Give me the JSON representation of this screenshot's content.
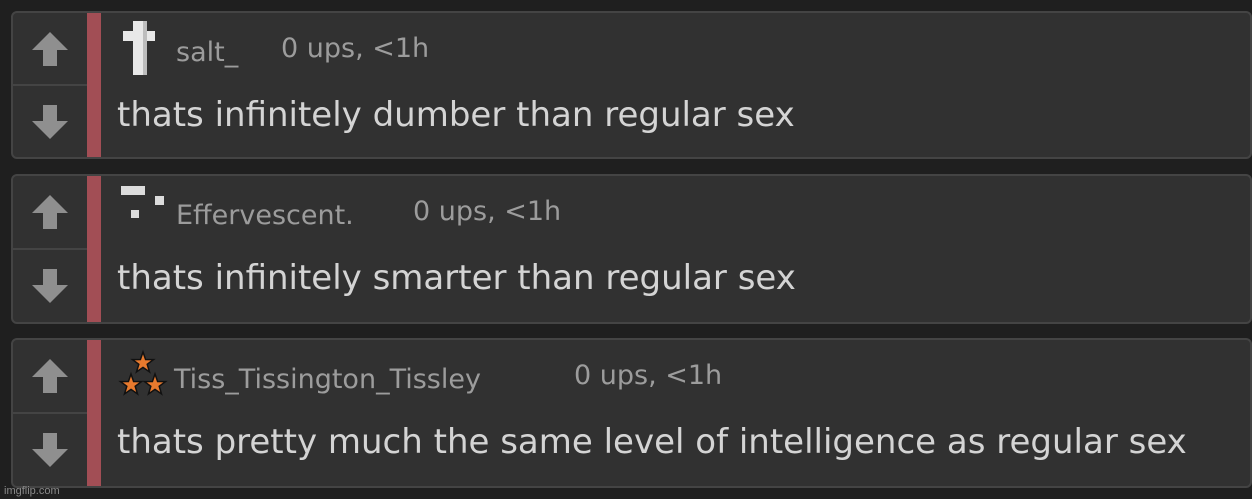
{
  "comments": [
    {
      "username": "salt_",
      "stats": "0 ups, <1h",
      "text": "thats infinitely dumber than regular sex"
    },
    {
      "username": "Effervescent.",
      "stats": "0 ups, <1h",
      "text": "thats infinitely smarter than regular sex"
    },
    {
      "username": "Tiss_Tissington_Tissley",
      "stats": "0 ups, <1h",
      "text": "thats pretty much the same level of intelligence as regular sex"
    }
  ],
  "icons": {
    "upvote": "arrow-up-icon",
    "downvote": "arrow-down-icon"
  },
  "colors": {
    "background": "#1f1f1f",
    "card": "#313131",
    "accent_bar": "#a24e55",
    "meta_text": "#9c9c9c",
    "body_text": "#d4d4d4",
    "arrow": "#8f8f8f"
  },
  "watermark": "imgflip.com"
}
